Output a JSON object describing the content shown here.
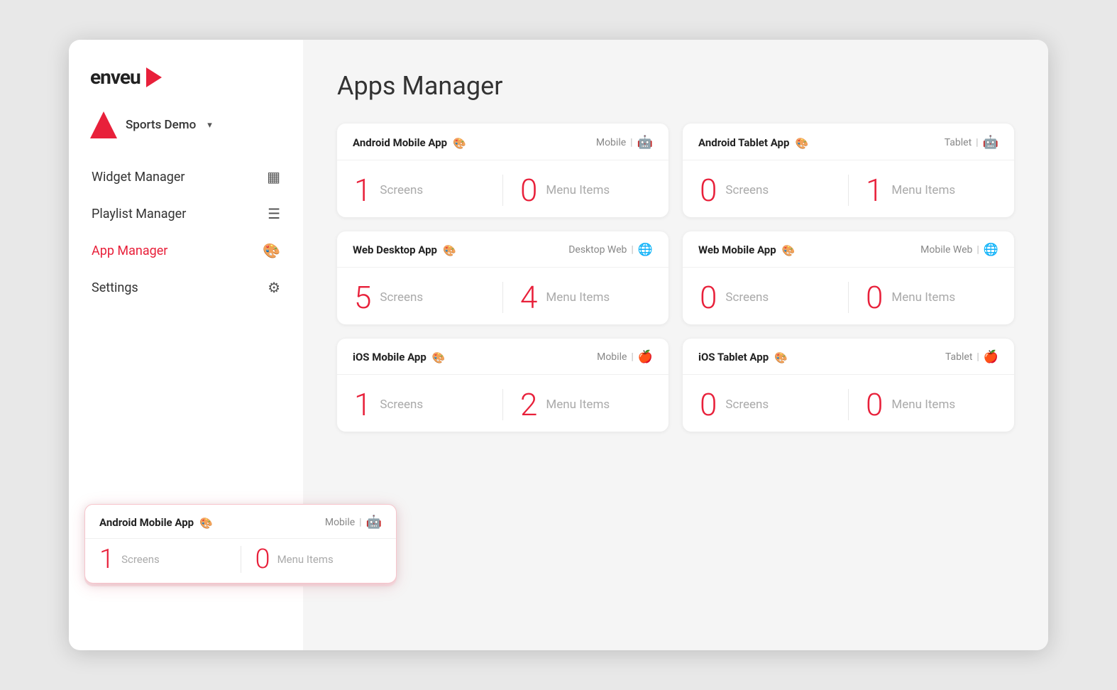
{
  "brand": {
    "name": "enveu",
    "arrow_color": "#e8203a"
  },
  "account": {
    "name": "Sports Demo",
    "chevron": "▾"
  },
  "sidebar": {
    "nav_items": [
      {
        "id": "widget-manager",
        "label": "Widget Manager",
        "icon": "▦",
        "active": false
      },
      {
        "id": "playlist-manager",
        "label": "Playlist Manager",
        "icon": "≡",
        "active": false
      },
      {
        "id": "app-manager",
        "label": "App Manager",
        "icon": "🎨",
        "active": true
      },
      {
        "id": "settings",
        "label": "Settings",
        "icon": "⚙",
        "active": false
      }
    ]
  },
  "page": {
    "title": "Apps Manager"
  },
  "apps": [
    {
      "id": "android-mobile",
      "name": "Android Mobile App",
      "platform_label": "Mobile",
      "platform_type": "android",
      "screens": 1,
      "menu_items": 0
    },
    {
      "id": "android-tablet",
      "name": "Android Tablet App",
      "platform_label": "Tablet",
      "platform_type": "android",
      "screens": 0,
      "menu_items": 1
    },
    {
      "id": "web-desktop",
      "name": "Web Desktop App",
      "platform_label": "Desktop Web",
      "platform_type": "web",
      "screens": 5,
      "menu_items": 4
    },
    {
      "id": "web-mobile",
      "name": "Web Mobile App",
      "platform_label": "Mobile Web",
      "platform_type": "web",
      "screens": 0,
      "menu_items": 0
    },
    {
      "id": "ios-mobile",
      "name": "iOS Mobile App",
      "platform_label": "Mobile",
      "platform_type": "apple",
      "screens": 1,
      "menu_items": 2
    },
    {
      "id": "ios-tablet",
      "name": "iOS Tablet App",
      "platform_label": "Tablet",
      "platform_type": "apple",
      "screens": 0,
      "menu_items": 0
    }
  ],
  "floating_card": {
    "name": "Android Mobile App",
    "platform_label": "Mobile",
    "platform_type": "android",
    "screens": 1,
    "menu_items": 0
  },
  "labels": {
    "screens": "Screens",
    "menu_items": "Menu Items"
  }
}
